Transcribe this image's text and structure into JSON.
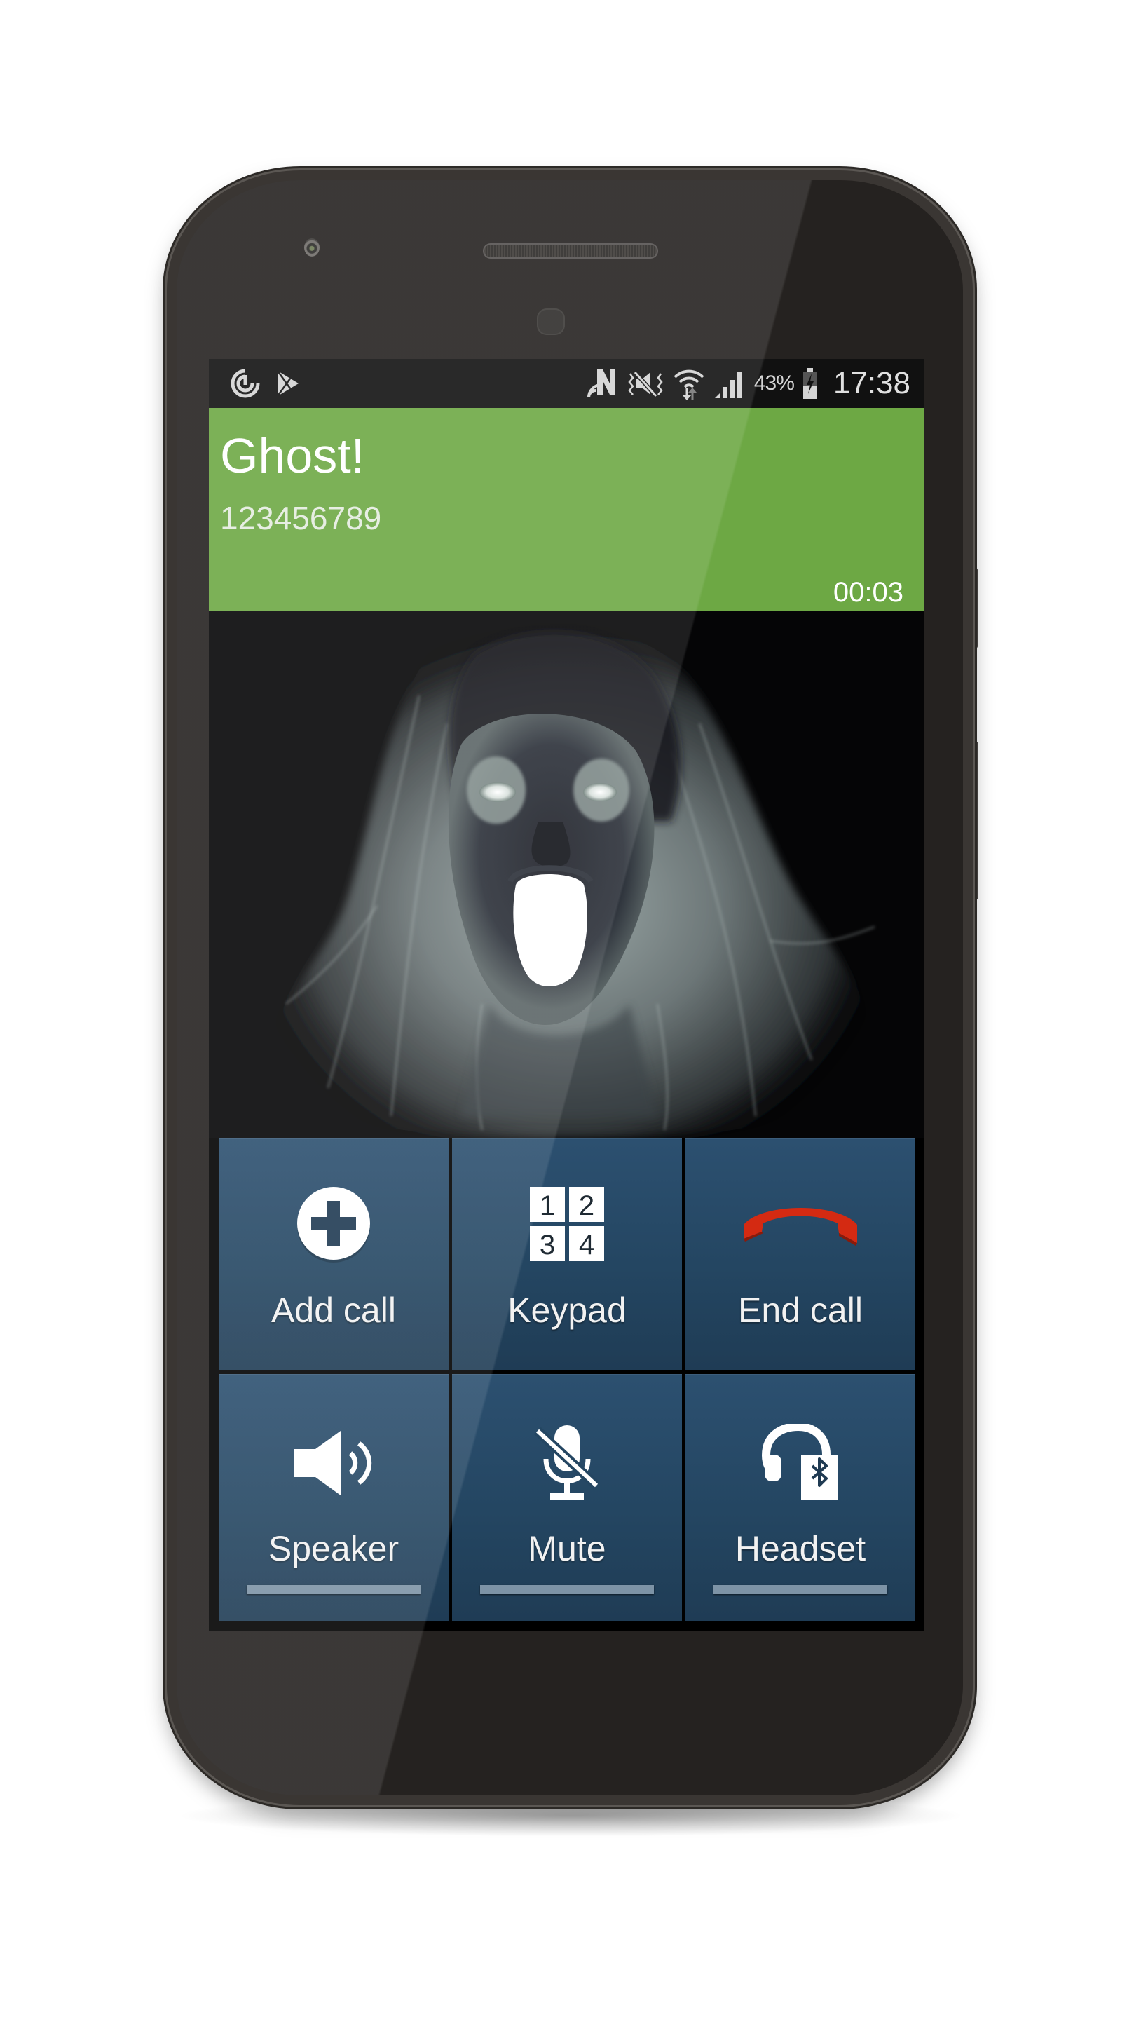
{
  "status_bar": {
    "left_icons": [
      "sync-timer-icon",
      "play-store-icon"
    ],
    "right_icons": [
      "nfc-icon",
      "vibrate-mute-icon",
      "wifi-icon",
      "signal-icon",
      "battery-charging-icon"
    ],
    "battery_percent": "43%",
    "time": "17:38"
  },
  "call": {
    "caller_name": "Ghost!",
    "caller_number": "123456789",
    "duration": "00:03",
    "header_color": "#6da844"
  },
  "photo": {
    "description": "ghost-face-photo"
  },
  "buttons": [
    {
      "id": "add-call",
      "label": "Add call",
      "icon": "add-circle-icon"
    },
    {
      "id": "keypad",
      "label": "Keypad",
      "icon": "keypad-icon",
      "digits": [
        "1",
        "2",
        "3",
        "4"
      ]
    },
    {
      "id": "end-call",
      "label": "End call",
      "icon": "end-call-icon",
      "color": "#d42a12"
    },
    {
      "id": "speaker",
      "label": "Speaker",
      "icon": "speaker-icon",
      "toggle": true
    },
    {
      "id": "mute",
      "label": "Mute",
      "icon": "mic-off-icon",
      "toggle": true
    },
    {
      "id": "headset",
      "label": "Headset",
      "icon": "bluetooth-headset-icon",
      "toggle": true
    }
  ]
}
